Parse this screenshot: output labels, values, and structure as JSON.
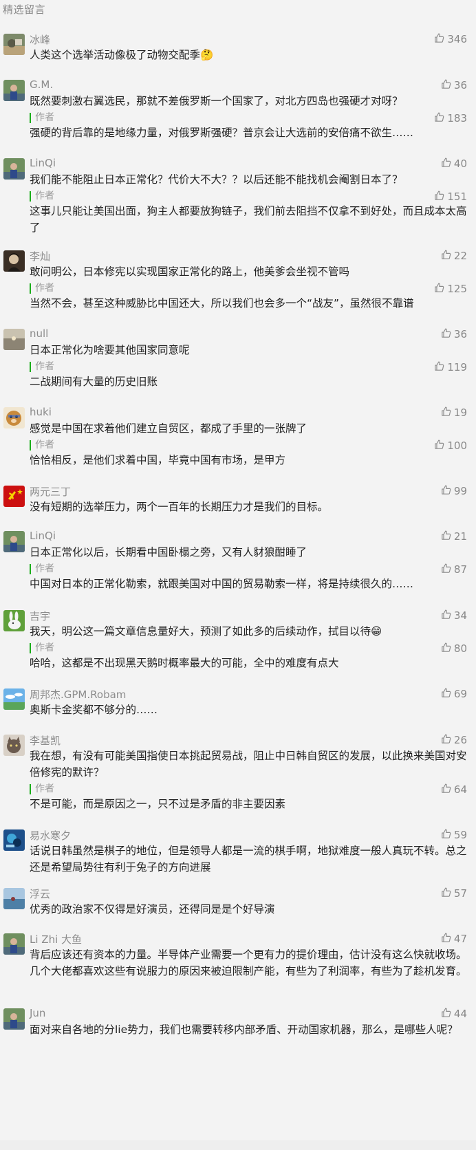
{
  "section_title": "精选留言",
  "colors": {
    "background": "#f3f3f3",
    "author_accent": "#1aad19",
    "meta_text": "#888888"
  },
  "comments": [
    {
      "nickname": "冰峰",
      "avatar": "rock-landscape-avatar",
      "likes": "346",
      "text": "人类这个选举活动像极了动物交配季🤔"
    },
    {
      "nickname": "G.M.",
      "avatar": "person-avatar",
      "likes": "36",
      "text": "既然要刺激右翼选民，那就不差俄罗斯一个国家了，对北方四岛也强硬才对呀？",
      "reply": {
        "tag": "作者",
        "likes": "183",
        "text": "强硬的背后靠的是地缘力量，对俄罗斯强硬？普京会让大选前的安倍痛不欲生……"
      }
    },
    {
      "nickname": "LinQi",
      "avatar": "person-avatar",
      "likes": "40",
      "text": "我们能不能阻止日本正常化？代价大不大？？以后还能不能找机会阉割日本了？",
      "reply": {
        "tag": "作者",
        "likes": "151",
        "text": "这事儿只能让美国出面，狗主人都要放狗链子，我们前去阻挡不仅拿不到好处，而且成本太高了"
      }
    },
    {
      "nickname": "李灿",
      "avatar": "portrait-avatar",
      "likes": "22",
      "text": "敢问明公，日本修宪以实现国家正常化的路上，他美爹会坐视不管吗",
      "reply": {
        "tag": "作者",
        "likes": "125",
        "text": "当然不会，甚至这种威胁比中国还大，所以我们也会多一个“战友”，虽然很不靠谱"
      }
    },
    {
      "nickname": "null",
      "avatar": "sunset-avatar",
      "likes": "36",
      "text": "日本正常化为啥要其他国家同意呢",
      "reply": {
        "tag": "作者",
        "likes": "119",
        "text": "二战期间有大量的历史旧账"
      }
    },
    {
      "nickname": "huki",
      "avatar": "dog-avatar",
      "likes": "19",
      "text": "感觉是中国在求着他们建立自贸区，都成了手里的一张牌了",
      "reply": {
        "tag": "作者",
        "likes": "100",
        "text": "恰恰相反，是他们求着中国，毕竟中国有市场，是甲方"
      }
    },
    {
      "nickname": "两元三丁",
      "avatar": "red-flag-avatar",
      "likes": "99",
      "text": "没有短期的选举压力，两个一百年的长期压力才是我们的目标。"
    },
    {
      "nickname": "LinQi",
      "avatar": "person-avatar",
      "likes": "21",
      "text": "日本正常化以后，长期看中国卧榻之旁，又有人豺狼酣睡了",
      "reply": {
        "tag": "作者",
        "likes": "87",
        "text": "中国对日本的正常化勒索，就跟美国对中国的贸易勒索一样，将是持续很久的……"
      }
    },
    {
      "nickname": "吉宇",
      "avatar": "rabbit-avatar",
      "likes": "34",
      "text": "我天，明公这一篇文章信息量好大，预测了如此多的后续动作，拭目以待😁",
      "reply": {
        "tag": "作者",
        "likes": "80",
        "text": "哈哈，这都是不出现黑天鹅时概率最大的可能，全中的难度有点大"
      }
    },
    {
      "nickname": "周邦杰.GPM.Robam",
      "avatar": "sky-avatar",
      "likes": "69",
      "text": "奥斯卡金奖都不够分的……"
    },
    {
      "nickname": "李基凯",
      "avatar": "cat-avatar",
      "likes": "26",
      "text": "我在想，有没有可能美国指使日本挑起贸易战，阻止中日韩自贸区的发展，以此换来美国对安倍修宪的默许？",
      "reply": {
        "tag": "作者",
        "likes": "64",
        "text": "不是可能，而是原因之一，只不过是矛盾的非主要因素"
      }
    },
    {
      "nickname": "易水寒夕",
      "avatar": "blue-art-avatar",
      "likes": "59",
      "text": "话说日韩虽然是棋子的地位，但是领导人都是一流的棋手啊，地狱难度一般人真玩不转。总之还是希望局势往有利于兔子的方向进展"
    },
    {
      "nickname": "浮云",
      "avatar": "lake-avatar",
      "likes": "57",
      "text": "优秀的政治家不仅得是好演员，还得同是是个好导演"
    },
    {
      "nickname": "Li Zhi 大鱼",
      "avatar": "person-avatar",
      "likes": "47",
      "text": "背后应该还有资本的力量。半导体产业需要一个更有力的提价理由，估计没有这么快就收场。几个大佬都喜欢这些有说服力的原因来被迫限制产能，有些为了利润率，有些为了趁机发育。"
    },
    {
      "nickname": "Jun",
      "avatar": "person-avatar",
      "likes": "44",
      "text": "面对来自各地的分lie势力，我们也需要转移内部矛盾、开动国家机器，那么，是哪些人呢？"
    }
  ]
}
